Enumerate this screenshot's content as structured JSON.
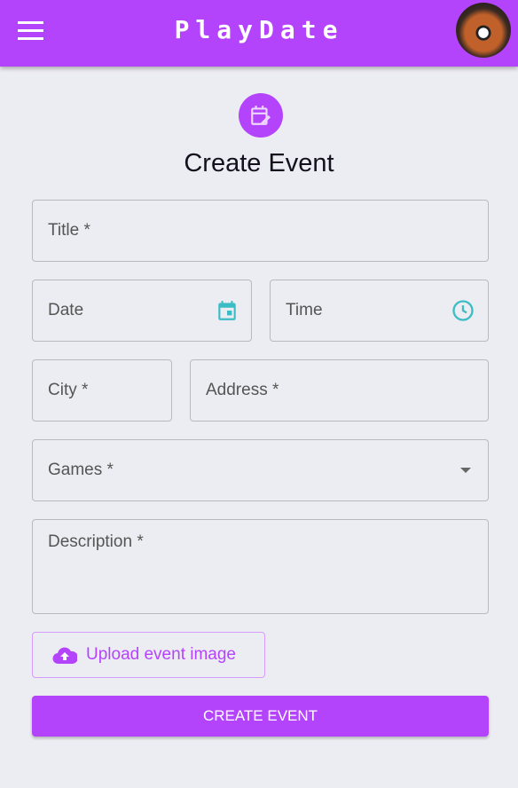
{
  "app": {
    "title": "PlayDate"
  },
  "page": {
    "title": "Create Event"
  },
  "form": {
    "title": "Title *",
    "date": "Date",
    "time": "Time",
    "city": "City *",
    "address": "Address *",
    "games": "Games *",
    "description": "Description *",
    "upload_label": "Upload event image",
    "submit_label": "CREATE EVENT"
  },
  "colors": {
    "primary": "#b444fb",
    "icon_accent": "#3cbcc4",
    "background": "#ecedf2"
  },
  "icons": [
    "menu-icon",
    "calendar-edit-icon",
    "calendar-icon",
    "clock-icon",
    "dropdown-arrow-icon",
    "cloud-upload-icon"
  ]
}
